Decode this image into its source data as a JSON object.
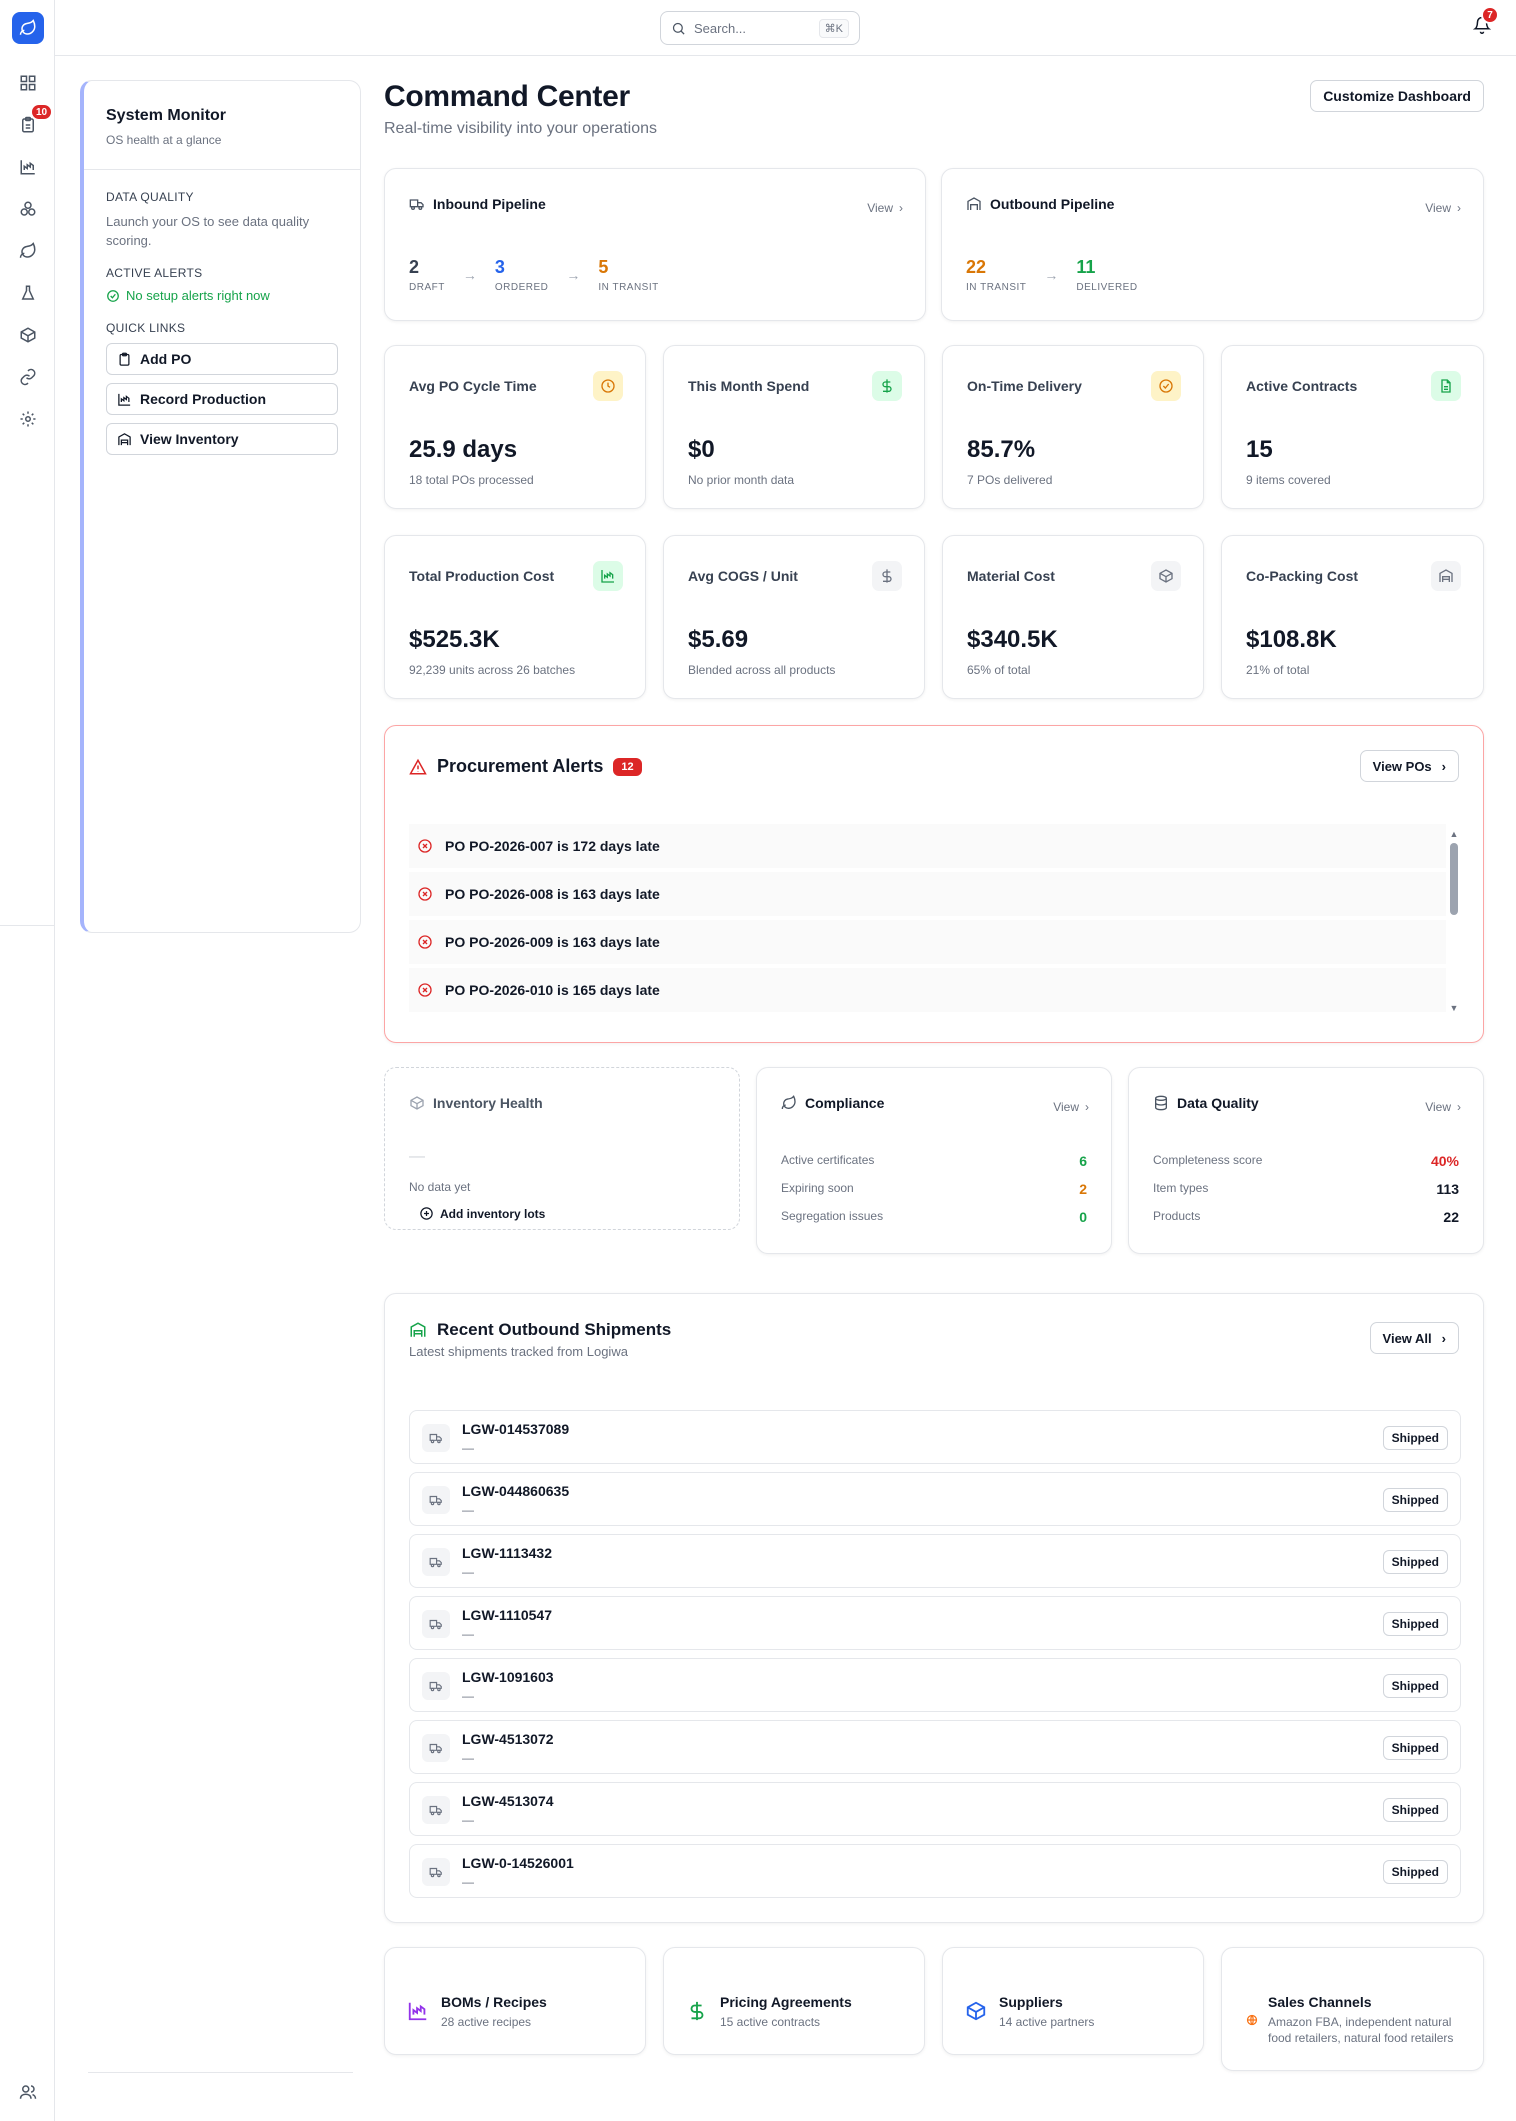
{
  "nav": {
    "alerts_badge": "10",
    "icons": [
      "dashboard-icon",
      "clipboard-icon",
      "production-chart-icon",
      "cubes-icon",
      "leaf-icon",
      "flask-icon",
      "box-icon",
      "link-icon",
      "settings-icon"
    ],
    "bottom_icon": "users-icon"
  },
  "topbar": {
    "search_placeholder": "Search...",
    "shortcut": "⌘K",
    "notifications_count": "7"
  },
  "system_monitor": {
    "title": "System Monitor",
    "subtitle": "OS health at a glance",
    "data_quality_label": "DATA QUALITY",
    "data_quality_text": "Launch your OS to see data quality scoring.",
    "active_alerts_label": "ACTIVE ALERTS",
    "active_alerts_text": "No setup alerts right now",
    "quick_links_label": "QUICK LINKS",
    "quick_links": [
      "Add PO",
      "Record Production",
      "View Inventory"
    ]
  },
  "header": {
    "title": "Command Center",
    "subtitle": "Real-time visibility into your operations",
    "customize_label": "Customize Dashboard"
  },
  "inbound": {
    "title": "Inbound Pipeline",
    "view_label": "View",
    "stages": [
      {
        "value": "2",
        "label": "DRAFT",
        "color": "#374151"
      },
      {
        "value": "3",
        "label": "ORDERED",
        "color": "#2563eb"
      },
      {
        "value": "5",
        "label": "IN TRANSIT",
        "color": "#d97706"
      }
    ]
  },
  "outbound": {
    "title": "Outbound Pipeline",
    "view_label": "View",
    "stages": [
      {
        "value": "22",
        "label": "IN TRANSIT",
        "color": "#d97706"
      },
      {
        "value": "11",
        "label": "DELIVERED",
        "color": "#16a34a"
      }
    ]
  },
  "kpis": [
    {
      "title": "Avg PO Cycle Time",
      "value": "25.9 days",
      "sub": "18 total POs processed",
      "icon": "clock-icon",
      "bg": "#fef3c7",
      "fg": "#d97706"
    },
    {
      "title": "This Month Spend",
      "value": "$0",
      "sub": "No prior month data",
      "icon": "dollar-icon",
      "bg": "#dcfce7",
      "fg": "#16a34a"
    },
    {
      "title": "On-Time Delivery",
      "value": "85.7%",
      "sub": "7 POs delivered",
      "icon": "check-circle-icon",
      "bg": "#fef3c7",
      "fg": "#d97706"
    },
    {
      "title": "Active Contracts",
      "value": "15",
      "sub": "9 items covered",
      "icon": "document-icon",
      "bg": "#dcfce7",
      "fg": "#16a34a"
    },
    {
      "title": "Total Production Cost",
      "value": "$525.3K",
      "sub": "92,239 units across 26 batches",
      "icon": "production-chart-icon",
      "bg": "#dcfce7",
      "fg": "#16a34a"
    },
    {
      "title": "Avg COGS / Unit",
      "value": "$5.69",
      "sub": "Blended across all products",
      "icon": "dollar-icon",
      "bg": "#f3f4f6",
      "fg": "#6b7280"
    },
    {
      "title": "Material Cost",
      "value": "$340.5K",
      "sub": "65% of total",
      "icon": "box-icon",
      "bg": "#f3f4f6",
      "fg": "#6b7280"
    },
    {
      "title": "Co-Packing Cost",
      "value": "$108.8K",
      "sub": "21% of total",
      "icon": "warehouse-icon",
      "bg": "#f3f4f6",
      "fg": "#6b7280"
    }
  ],
  "alerts": {
    "title": "Procurement Alerts",
    "count": "12",
    "view_label": "View POs",
    "items": [
      "PO PO-2026-007 is 172 days late",
      "PO PO-2026-008 is 163 days late",
      "PO PO-2026-009 is 163 days late",
      "PO PO-2026-010 is 165 days late"
    ]
  },
  "inventory_health": {
    "title": "Inventory Health",
    "dash": "—",
    "empty_text": "No data yet",
    "add_label": "Add inventory lots"
  },
  "compliance": {
    "title": "Compliance",
    "view_label": "View",
    "rows": [
      {
        "label": "Active certificates",
        "value": "6",
        "color": "#16a34a"
      },
      {
        "label": "Expiring soon",
        "value": "2",
        "color": "#d97706"
      },
      {
        "label": "Segregation issues",
        "value": "0",
        "color": "#16a34a"
      }
    ]
  },
  "data_quality": {
    "title": "Data Quality",
    "view_label": "View",
    "rows": [
      {
        "label": "Completeness score",
        "value": "40%",
        "color": "#dc2626"
      },
      {
        "label": "Item types",
        "value": "113",
        "color": "#111827"
      },
      {
        "label": "Products",
        "value": "22",
        "color": "#111827"
      }
    ]
  },
  "shipments": {
    "title": "Recent Outbound Shipments",
    "subtitle": "Latest shipments tracked from Logiwa",
    "view_label": "View All",
    "items": [
      {
        "id": "LGW-014537089",
        "detail": "—",
        "status": "Shipped"
      },
      {
        "id": "LGW-044860635",
        "detail": "—",
        "status": "Shipped"
      },
      {
        "id": "LGW-1113432",
        "detail": "—",
        "status": "Shipped"
      },
      {
        "id": "LGW-1110547",
        "detail": "—",
        "status": "Shipped"
      },
      {
        "id": "LGW-1091603",
        "detail": "—",
        "status": "Shipped"
      },
      {
        "id": "LGW-4513072",
        "detail": "—",
        "status": "Shipped"
      },
      {
        "id": "LGW-4513074",
        "detail": "—",
        "status": "Shipped"
      },
      {
        "id": "LGW-0-14526001",
        "detail": "—",
        "status": "Shipped"
      }
    ]
  },
  "footer_cards": [
    {
      "title": "BOMs / Recipes",
      "sub": "28 active recipes",
      "icon": "production-chart-icon",
      "color": "#9333ea"
    },
    {
      "title": "Pricing Agreements",
      "sub": "15 active contracts",
      "icon": "dollar-icon",
      "color": "#16a34a"
    },
    {
      "title": "Suppliers",
      "sub": "14 active partners",
      "icon": "box-icon",
      "color": "#2563eb"
    },
    {
      "title": "Sales Channels",
      "sub": "Amazon FBA, independent natural food retailers, natural food retailers",
      "icon": "globe-icon",
      "color": "#f97316"
    }
  ]
}
